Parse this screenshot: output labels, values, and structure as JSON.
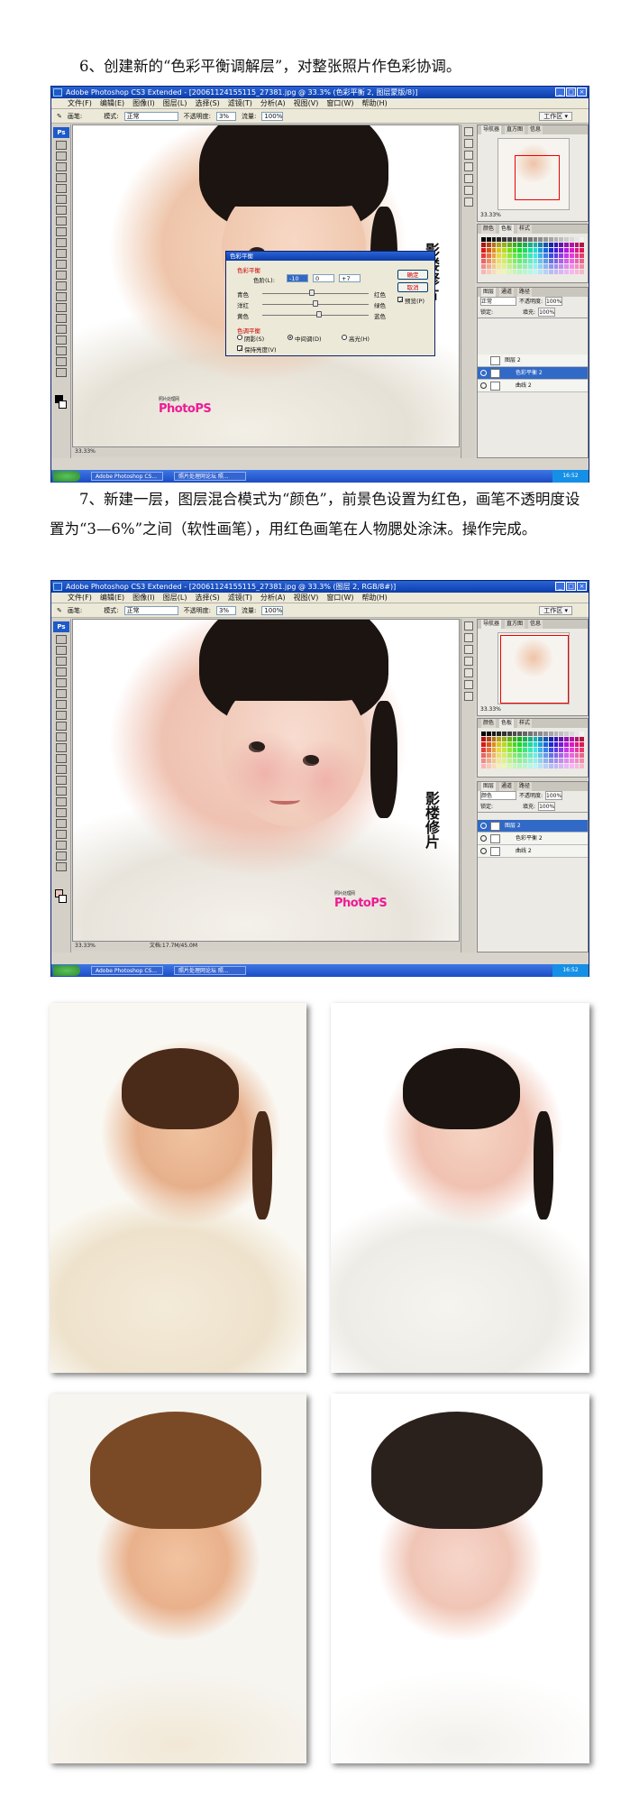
{
  "step6": {
    "text": "6、创建新的“色彩平衡调解层”，对整张照片作色彩协调。"
  },
  "step7": {
    "text": "7、新建一层，图层混合模式为“颜色”，前景色设置为红色，画笔不透明度设置为“3—6%”之间（软性画笔），用红色画笔在人物腮处涂沫。操作完成。"
  },
  "shot1": {
    "title": "Adobe Photoshop CS3 Extended - [20061124155115_27381.jpg @ 33.3% (色彩平衡 2, 图层蒙版/8)]",
    "menu": [
      "文件(F)",
      "编辑(E)",
      "图像(I)",
      "图层(L)",
      "选择(S)",
      "滤镜(T)",
      "分析(A)",
      "视图(V)",
      "窗口(W)",
      "帮助(H)"
    ],
    "opt": {
      "brush": "画笔:",
      "mode_label": "模式:",
      "mode": "正常",
      "opacity_label": "不透明度:",
      "opacity": "3%",
      "flow_label": "流量:",
      "flow": "100%",
      "workspace": "工作区 ▾"
    },
    "panel_tabs_nav": [
      "导航器",
      "直方图",
      "信息"
    ],
    "nav_zoom": "33.33%",
    "panel_tabs_color": [
      "颜色",
      "色板",
      "样式"
    ],
    "panel_tabs_layers": [
      "图层",
      "通道",
      "路径"
    ],
    "layers_blend": "正常",
    "layers_opacity_label": "不透明度:",
    "layers_opacity": "100%",
    "layers_lock": "锁定:",
    "layers_fill_label": "填充:",
    "layers_fill": "100%",
    "layers": [
      "图层 2",
      "色彩平衡 2",
      "曲线 2"
    ],
    "status_zoom": "33.33%",
    "dialog": {
      "title": "色彩平衡",
      "group1": "色彩平衡",
      "levels_label": "色阶(L):",
      "l1": "-10",
      "l2": "0",
      "l3": "+7",
      "ok": "确定",
      "cancel": "取消",
      "preview": "预览(P)",
      "c1": "青色",
      "r1": "红色",
      "c2": "洋红",
      "r2": "绿色",
      "c3": "黄色",
      "r3": "蓝色",
      "group2": "色调平衡",
      "shadow": "阴影(S)",
      "mid": "中间调(D)",
      "high": "高光(H)",
      "keep": "保持亮度(V)"
    },
    "task": [
      "Adobe Photoshop CS...",
      "照片处理网论坛 照..."
    ],
    "clock": "16:52"
  },
  "shot2": {
    "title": "Adobe Photoshop CS3 Extended - [20061124155115_27381.jpg @ 33.3% (图层 2, RGB/8#)]",
    "menu": [
      "文件(F)",
      "编辑(E)",
      "图像(I)",
      "图层(L)",
      "选择(S)",
      "滤镜(T)",
      "分析(A)",
      "视图(V)",
      "窗口(W)",
      "帮助(H)"
    ],
    "opt": {
      "brush": "画笔:",
      "mode_label": "模式:",
      "mode": "正常",
      "opacity_label": "不透明度:",
      "opacity": "3%",
      "flow_label": "流量:",
      "flow": "100%",
      "workspace": "工作区 ▾"
    },
    "panel_tabs_nav": [
      "导航器",
      "直方图",
      "信息"
    ],
    "nav_zoom": "33.33%",
    "panel_tabs_color": [
      "颜色",
      "色板",
      "样式"
    ],
    "panel_tabs_layers": [
      "图层",
      "通道",
      "路径"
    ],
    "layers_blend": "颜色",
    "layers_opacity_label": "不透明度:",
    "layers_opacity": "100%",
    "layers_lock": "锁定:",
    "layers_fill_label": "填充:",
    "layers_fill": "100%",
    "layers": [
      "图层 2",
      "色彩平衡 2",
      "曲线 2"
    ],
    "status_zoom": "33.33%",
    "status_doc": "文档:17.7M/45.0M",
    "task": [
      "Adobe Photoshop CS...",
      "照片处理网论坛 照..."
    ],
    "clock": "16:52"
  },
  "brand": {
    "name": "PhotoPS",
    "sub": "照片处理网"
  },
  "signature": "影楼修片"
}
